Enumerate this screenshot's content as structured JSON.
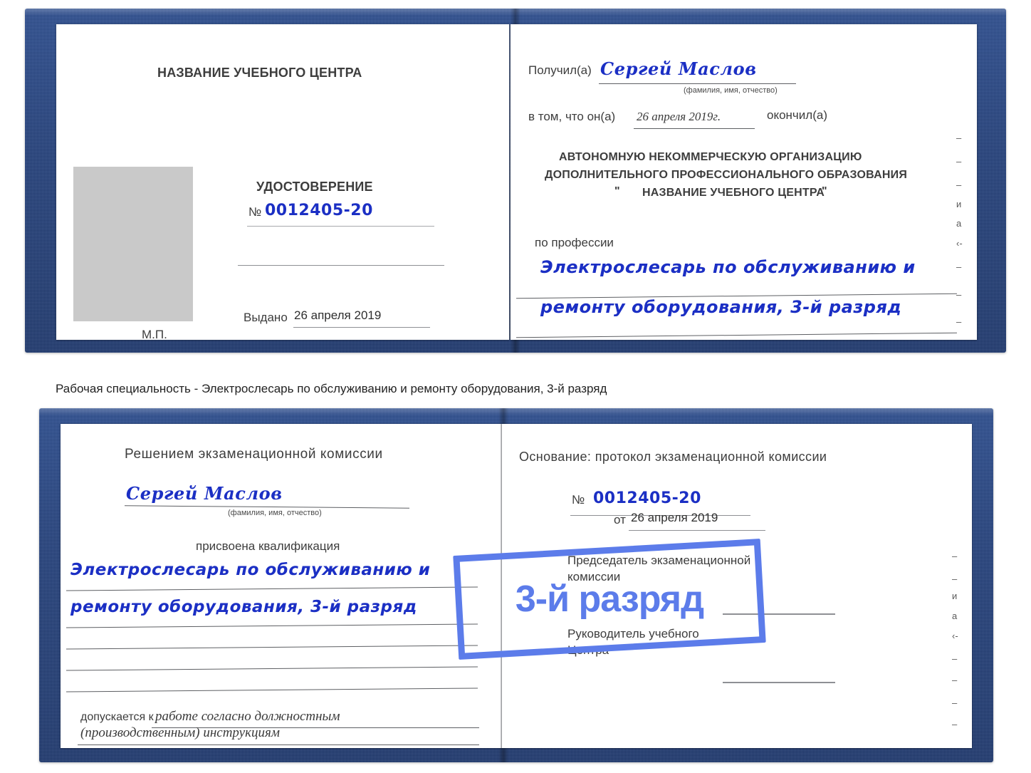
{
  "caption": "Рабочая специальность - Электрослесарь по обслуживанию и ремонту оборудования, 3-й разряд",
  "badge": {
    "label": "3-й разряд",
    "color": "#5c7cea"
  },
  "cover_color": "#23417e",
  "ink_color": "#1b2fc4",
  "certificate_top": {
    "left_page": {
      "center_title": "НАЗВАНИЕ УЧЕБНОГО ЦЕНТРА",
      "doc_type": "УДОСТОВЕРЕНИЕ",
      "number_label": "№",
      "number_value": "0012405-20",
      "issued_label": "Выдано",
      "issued_value": "26 апреля 2019",
      "stamp_label": "М.П.",
      "photo_placeholder": "photo-placeholder"
    },
    "right_page": {
      "received_label": "Получил(а)",
      "received_value": "Сергей Маслов",
      "fio_hint": "(фамилия, имя, отчество)",
      "that_he_label": "в том, что он(а)",
      "that_he_value": "26 апреля 2019г.",
      "finished_label": "окончил(а)",
      "org_line1": "АВТОНОМНУЮ НЕКОММЕРЧЕСКУЮ ОРГАНИЗАЦИЮ",
      "org_line2": "ДОПОЛНИТЕЛЬНОГО ПРОФЕССИОНАЛЬНОГО ОБРАЗОВАНИЯ",
      "org_quote_open": "\"",
      "org_line3": "НАЗВАНИЕ УЧЕБНОГО ЦЕНТРА",
      "org_quote_close": "\"",
      "profession_label": "по профессии",
      "profession_line1": "Электрослесарь по обслуживанию и",
      "profession_line2": "ремонту оборудования, 3-й разряд",
      "edge_fragments": [
        "–",
        "–",
        "–",
        "и",
        "а",
        "‹-",
        "–",
        "–",
        "–"
      ]
    }
  },
  "certificate_bottom": {
    "left_page": {
      "heading": "Решением экзаменационной комиссии",
      "name_value": "Сергей Маслов",
      "fio_hint": "(фамилия, имя, отчество)",
      "qualification_label": "присвоена квалификация",
      "qualification_line1": "Электрослесарь по обслуживанию и",
      "qualification_line2": "ремонту оборудования, 3-й разряд",
      "allowed_label": "допускается к",
      "allowed_value_line1": "работе согласно должностным",
      "allowed_value_line2": "(производственным) инструкциям"
    },
    "right_page": {
      "basis_label": "Основание: протокол экзаменационной комиссии",
      "number_label": "№",
      "number_value": "0012405-20",
      "date_label": "от",
      "date_value": "26 апреля 2019",
      "chairman_line1": "Председатель экзаменационной",
      "chairman_line2": "комиссии",
      "head_line1": "Руководитель учебного",
      "head_line2": "Центра",
      "edge_fragments": [
        "–",
        "–",
        "и",
        "а",
        "‹-",
        "–",
        "–",
        "–",
        "–"
      ]
    }
  }
}
